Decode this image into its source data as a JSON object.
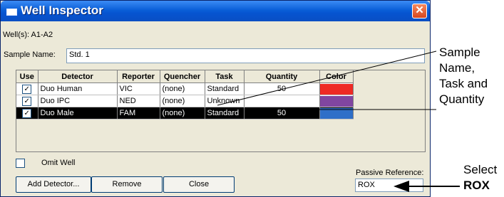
{
  "window": {
    "title": "Well Inspector",
    "close_glyph": "✕"
  },
  "wells": {
    "text": "Well(s): A1-A2"
  },
  "sample_name": {
    "label": "Sample Name:",
    "value": "Std. 1"
  },
  "table": {
    "columns": [
      "Use",
      "Detector",
      "Reporter",
      "Quencher",
      "Task",
      "Quantity",
      "Color"
    ],
    "rows": [
      {
        "detector": "Duo Human",
        "reporter": "VIC",
        "quencher": "(none)",
        "task": "Standard",
        "quantity": "50",
        "color": "#ee2a24",
        "selected": false
      },
      {
        "detector": "Duo IPC",
        "reporter": "NED",
        "quencher": "(none)",
        "task": "Unknown",
        "quantity": "",
        "color": "#8046a0",
        "selected": false
      },
      {
        "detector": "Duo Male",
        "reporter": "FAM",
        "quencher": "(none)",
        "task": "Standard",
        "quantity": "50",
        "color": "#2f6fc8",
        "selected": true
      }
    ]
  },
  "omit_well": {
    "label": "Omit Well"
  },
  "passive_reference": {
    "label": "Passive Reference:",
    "value": "ROX"
  },
  "buttons": {
    "add_detector": "Add Detector...",
    "remove": "Remove",
    "close": "Close"
  },
  "callouts": {
    "sample_task": [
      "Sample",
      "Name,",
      "Task and",
      "Quantity"
    ],
    "select_prefix": "Select",
    "select_value": "ROX"
  }
}
